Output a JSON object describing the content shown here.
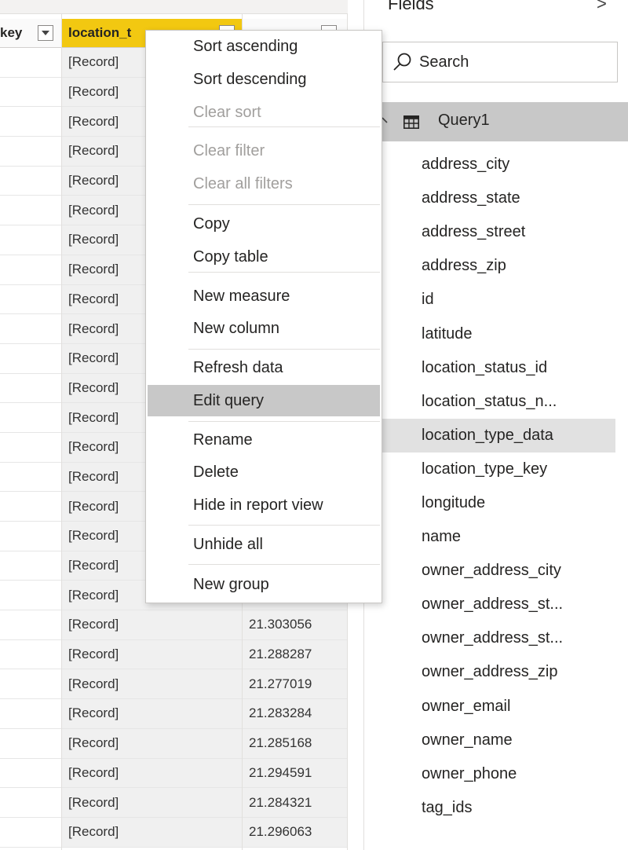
{
  "grid": {
    "headers": {
      "key_partial": "key",
      "location_type": "location_t",
      "latitude_partial": ""
    },
    "rows": [
      {
        "record": "[Record]",
        "latitude": ""
      },
      {
        "record": "[Record]",
        "latitude": ""
      },
      {
        "record": "[Record]",
        "latitude": ""
      },
      {
        "record": "[Record]",
        "latitude": ""
      },
      {
        "record": "[Record]",
        "latitude": ""
      },
      {
        "record": "[Record]",
        "latitude": ""
      },
      {
        "record": "[Record]",
        "latitude": ""
      },
      {
        "record": "[Record]",
        "latitude": ""
      },
      {
        "record": "[Record]",
        "latitude": ""
      },
      {
        "record": "[Record]",
        "latitude": ""
      },
      {
        "record": "[Record]",
        "latitude": ""
      },
      {
        "record": "[Record]",
        "latitude": ""
      },
      {
        "record": "[Record]",
        "latitude": ""
      },
      {
        "record": "[Record]",
        "latitude": ""
      },
      {
        "record": "[Record]",
        "latitude": ""
      },
      {
        "record": "[Record]",
        "latitude": ""
      },
      {
        "record": "[Record]",
        "latitude": ""
      },
      {
        "record": "[Record]",
        "latitude": ""
      },
      {
        "record": "[Record]",
        "latitude": ""
      },
      {
        "record": "[Record]",
        "latitude": "21.303056"
      },
      {
        "record": "[Record]",
        "latitude": "21.288287"
      },
      {
        "record": "[Record]",
        "latitude": "21.277019"
      },
      {
        "record": "[Record]",
        "latitude": "21.283284"
      },
      {
        "record": "[Record]",
        "latitude": "21.285168"
      },
      {
        "record": "[Record]",
        "latitude": "21.294591"
      },
      {
        "record": "[Record]",
        "latitude": "21.284321"
      },
      {
        "record": "[Record]",
        "latitude": "21.296063"
      }
    ]
  },
  "context_menu": {
    "items": [
      {
        "label": "Sort ascending",
        "enabled": true
      },
      {
        "label": "Sort descending",
        "enabled": true
      },
      {
        "label": "Clear sort",
        "enabled": false
      },
      {
        "label": "Clear filter",
        "enabled": false
      },
      {
        "label": "Clear all filters",
        "enabled": false
      },
      {
        "label": "Copy",
        "enabled": true
      },
      {
        "label": "Copy table",
        "enabled": true
      },
      {
        "label": "New measure",
        "enabled": true
      },
      {
        "label": "New column",
        "enabled": true
      },
      {
        "label": "Refresh data",
        "enabled": true
      },
      {
        "label": "Edit query",
        "enabled": true,
        "highlighted": true
      },
      {
        "label": "Rename",
        "enabled": true
      },
      {
        "label": "Delete",
        "enabled": true
      },
      {
        "label": "Hide in report view",
        "enabled": true
      },
      {
        "label": "Unhide all",
        "enabled": true
      },
      {
        "label": "New group",
        "enabled": true
      }
    ]
  },
  "fields_pane": {
    "title": "Fields",
    "collapse_glyph": ">",
    "search_placeholder": "Search",
    "table_name": "Query1",
    "fields": [
      "address_city",
      "address_state",
      "address_street",
      "address_zip",
      "id",
      "latitude",
      "location_status_id",
      "location_status_n...",
      "location_type_data",
      "location_type_key",
      "longitude",
      "name",
      "owner_address_city",
      "owner_address_st...",
      "owner_address_st...",
      "owner_address_zip",
      "owner_email",
      "owner_name",
      "owner_phone",
      "tag_ids"
    ],
    "selected_field": "location_type_data"
  },
  "colors": {
    "header_accent": "#f2c811",
    "highlight": "#c8c8c8",
    "disabled_text": "#a19f9d"
  }
}
